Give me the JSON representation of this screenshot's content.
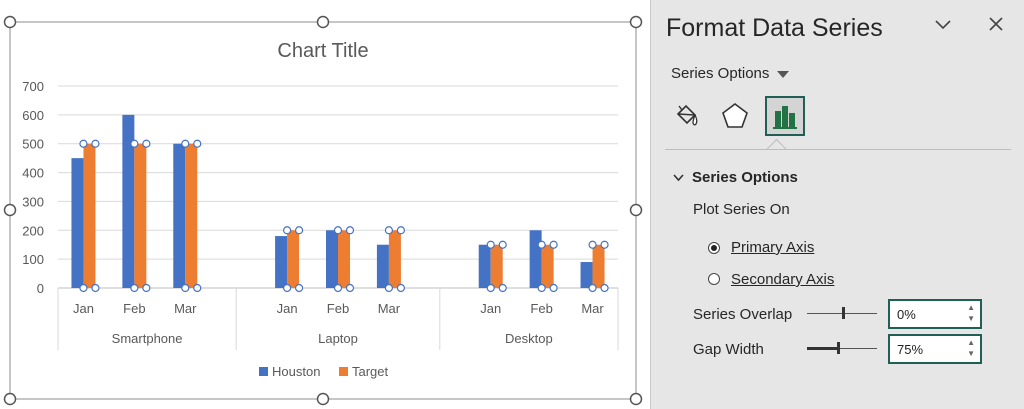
{
  "chart_data": {
    "type": "bar",
    "title": "Chart Title",
    "groups": [
      "Smartphone",
      "Laptop",
      "Desktop"
    ],
    "categories": [
      "Jan",
      "Feb",
      "Mar",
      "Jan",
      "Feb",
      "Mar",
      "Jan",
      "Feb",
      "Mar"
    ],
    "series": [
      {
        "name": "Houston",
        "color": "#4472c4",
        "values": [
          450,
          600,
          500,
          180,
          200,
          150,
          150,
          200,
          90
        ]
      },
      {
        "name": "Target",
        "color": "#ed7d31",
        "values": [
          500,
          500,
          500,
          200,
          200,
          200,
          150,
          150,
          150
        ]
      }
    ],
    "ylim": [
      0,
      700
    ],
    "yticks": [
      "0",
      "100",
      "200",
      "300",
      "400",
      "500",
      "600",
      "700"
    ],
    "legend": "bottom",
    "grid": true,
    "selected_series": "Target"
  },
  "pane": {
    "title": "Format Data Series",
    "options_dropdown": "Series Options",
    "tabs": [
      "fill-line-icon",
      "effects-icon",
      "series-options-icon"
    ],
    "section_title": "Series Options",
    "plot_on_label": "Plot Series On",
    "primary_axis": "Primary Axis",
    "secondary_axis": "Secondary Axis",
    "overlap": {
      "label": "Series Overlap",
      "value": "0%"
    },
    "gap": {
      "label": "Gap Width",
      "value": "75%"
    },
    "accent": "#1f5f55"
  }
}
